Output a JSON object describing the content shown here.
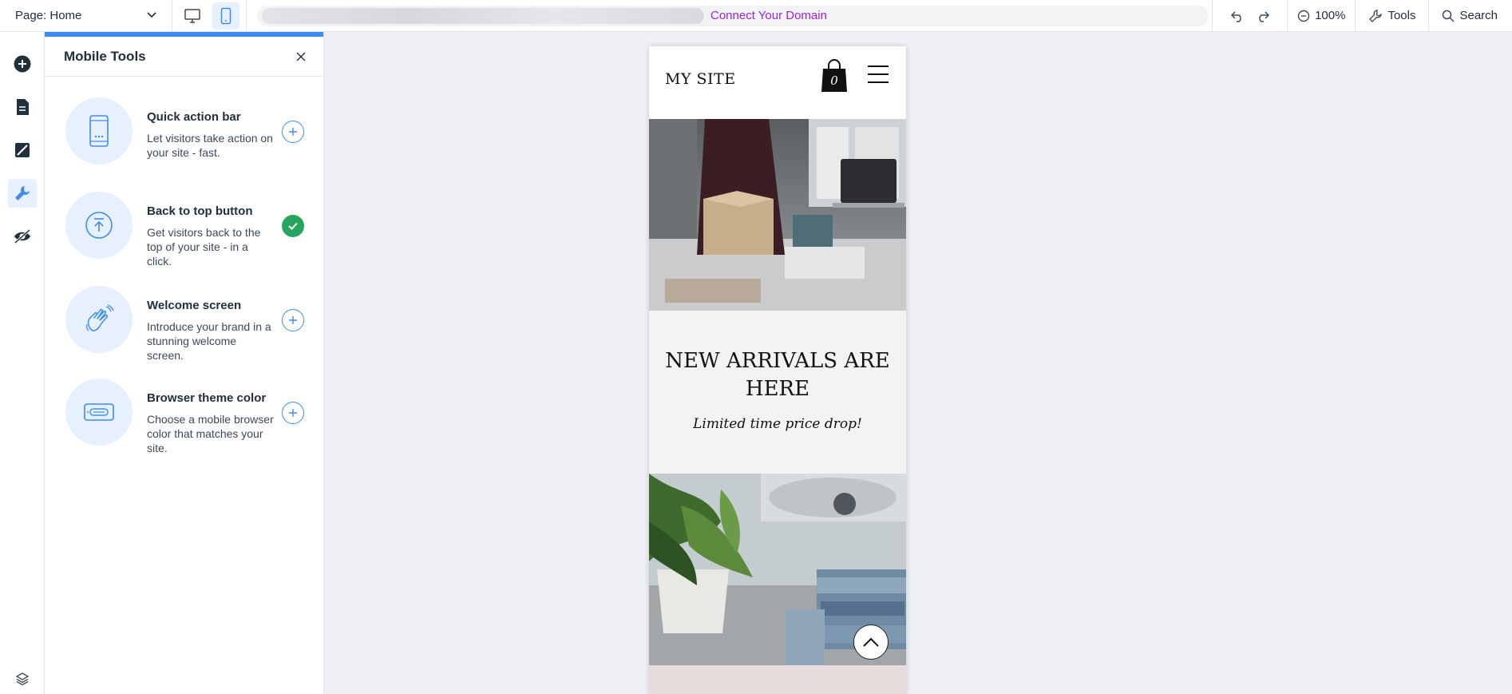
{
  "topbar": {
    "page_label": "Page: Home",
    "connect_domain": "Connect Your Domain",
    "zoom": "100%",
    "tools_label": "Tools",
    "search_label": "Search"
  },
  "panel": {
    "title": "Mobile Tools",
    "tools": [
      {
        "name": "Quick action bar",
        "desc": "Let visitors take action on your site - fast.",
        "state": "add"
      },
      {
        "name": "Back to top button",
        "desc": "Get visitors back to the top of your site - in a click.",
        "state": "added"
      },
      {
        "name": "Welcome screen",
        "desc": "Introduce your brand in a stunning welcome screen.",
        "state": "add"
      },
      {
        "name": "Browser theme color",
        "desc": "Choose a mobile browser color that matches your site.",
        "state": "add"
      }
    ]
  },
  "mobile": {
    "logo": "MY SITE",
    "cart_count": "0",
    "headline": "NEW ARRIVALS ARE HERE",
    "subheadline": "Limited time price drop!"
  },
  "colors": {
    "accent": "#3e8dee",
    "connect_link": "#9a27d5",
    "success": "#25a55f"
  }
}
